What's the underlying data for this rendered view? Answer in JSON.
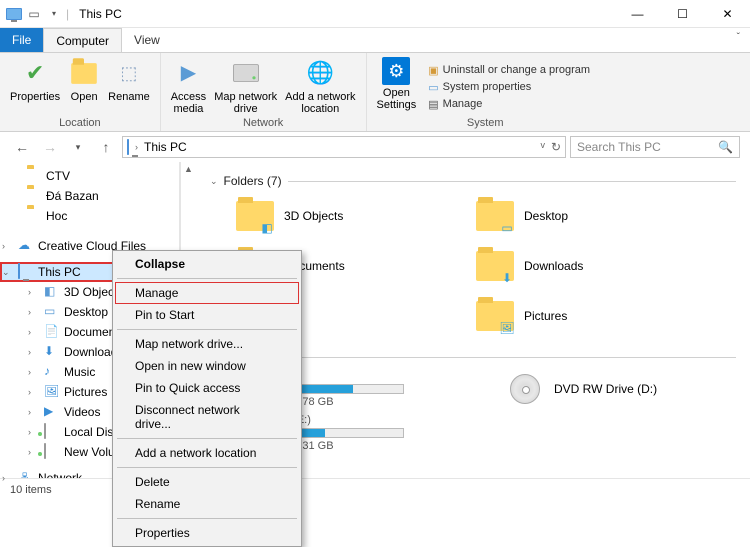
{
  "window": {
    "title": "This PC"
  },
  "tabs": {
    "file": "File",
    "computer": "Computer",
    "view": "View"
  },
  "ribbon": {
    "location": {
      "properties": "Properties",
      "open": "Open",
      "rename": "Rename",
      "group_label": "Location"
    },
    "network": {
      "access_media": "Access\nmedia",
      "map_drive": "Map network\ndrive",
      "add_location": "Add a network\nlocation",
      "group_label": "Network"
    },
    "system": {
      "open_settings": "Open\nSettings",
      "uninstall": "Uninstall or change a program",
      "sysprops": "System properties",
      "manage": "Manage",
      "group_label": "System"
    }
  },
  "nav": {
    "address": "This PC",
    "search_placeholder": "Search This PC"
  },
  "tree": {
    "ctv": "CTV",
    "dabazan": "Đá Bazan",
    "hoc": "Hoc",
    "ccf": "Creative Cloud Files",
    "thispc": "This PC",
    "objects3d": "3D Objects",
    "desktop": "Desktop",
    "documents": "Documents",
    "downloads": "Downloads",
    "music": "Music",
    "pictures": "Pictures",
    "videos": "Videos",
    "localdisk": "Local Disk (C:)",
    "newvolume": "New Volume (",
    "network": "Network"
  },
  "content": {
    "folders_header": "Folders (7)",
    "devices_header": "es (3)",
    "folders": {
      "objects3d": "3D Objects",
      "desktop": "Desktop",
      "documents": "Documents",
      "downloads": "Downloads",
      "pictures": "Pictures"
    },
    "devices": {
      "c_label": ":)",
      "c_sub": "of 178 GB",
      "e_label": "e (E:)",
      "e_sub": "of 931 GB",
      "dvd_label": "DVD RW Drive (D:)"
    }
  },
  "ctx": {
    "collapse": "Collapse",
    "manage": "Manage",
    "pin_start": "Pin to Start",
    "map_drive": "Map network drive...",
    "open_new": "Open in new window",
    "pin_quick": "Pin to Quick access",
    "disconnect": "Disconnect network drive...",
    "add_loc": "Add a network location",
    "delete": "Delete",
    "rename": "Rename",
    "properties": "Properties"
  },
  "statusbar": {
    "items": "10 items"
  }
}
